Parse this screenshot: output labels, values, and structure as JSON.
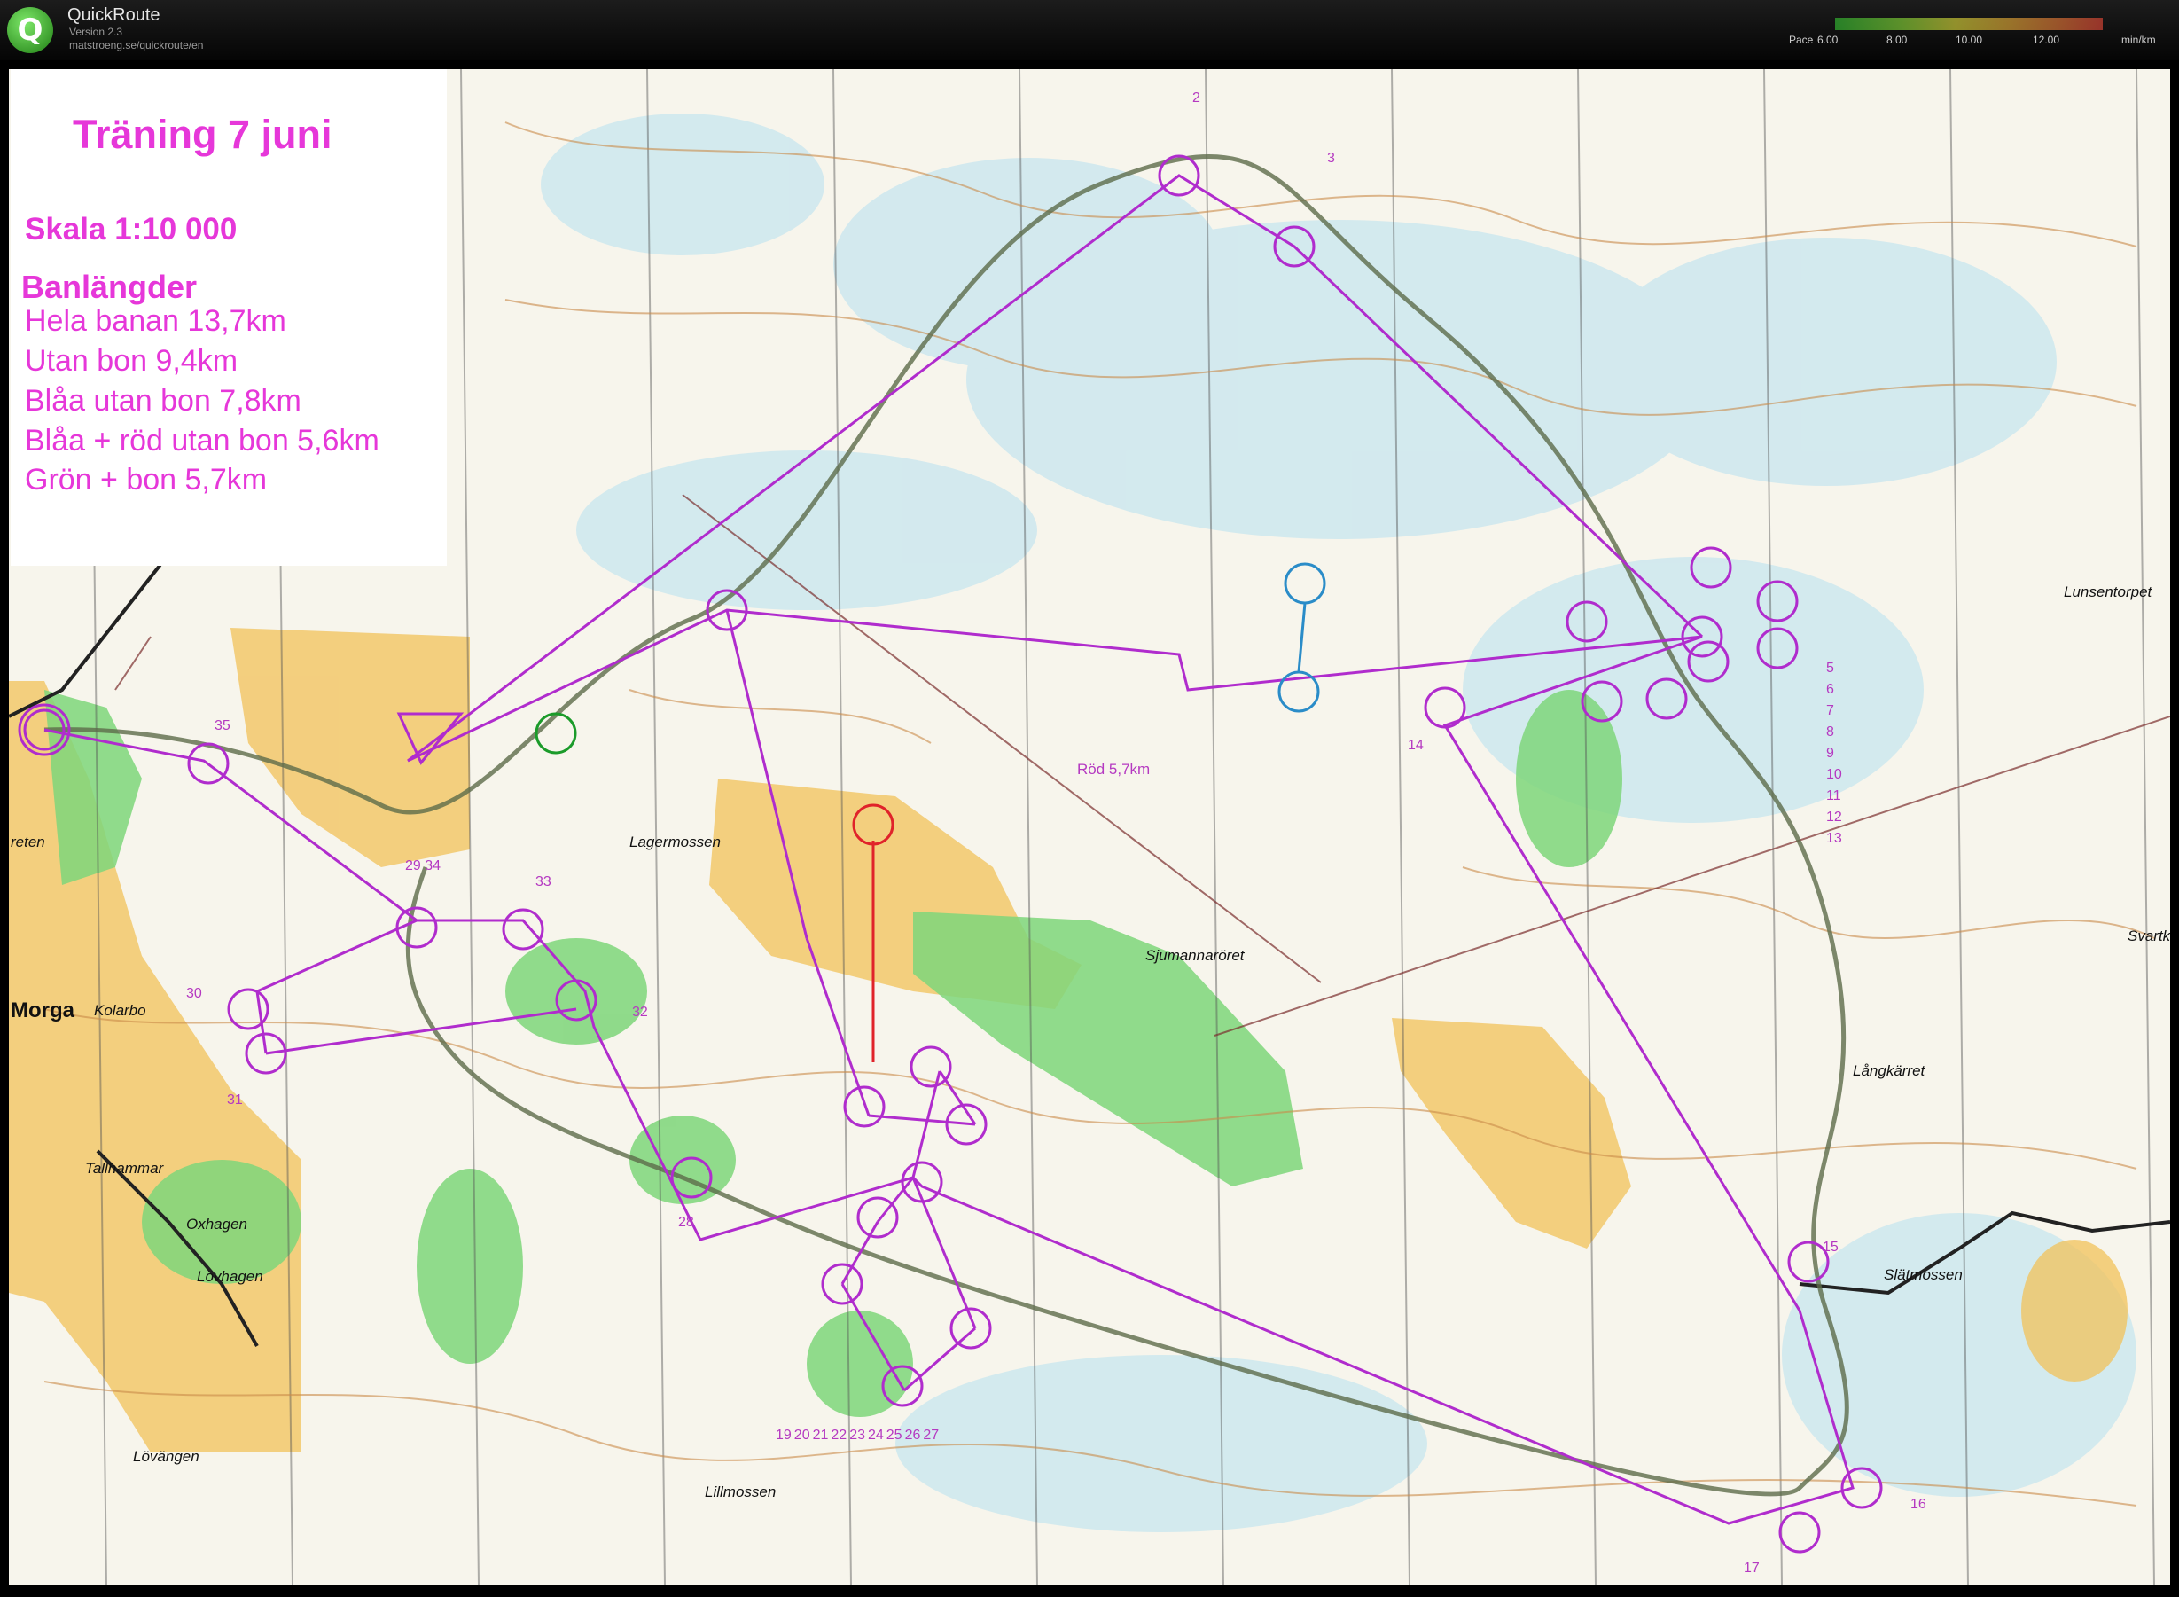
{
  "app": {
    "title": "QuickRoute",
    "version": "Version 2.3",
    "url": "matstroeng.se/quickroute/en"
  },
  "pace_scale": {
    "label": "Pace",
    "ticks": [
      "6.00",
      "8.00",
      "10.00",
      "12.00"
    ],
    "unit": "min/km",
    "colors": [
      "#35c935",
      "#8ee43a",
      "#e7e43c",
      "#f2b43a",
      "#f27a3a",
      "#f04a3a"
    ]
  },
  "legend": {
    "title": "Träning 7 juni",
    "scale": "Skala 1:10 000",
    "heading": "Banlängder",
    "lines": [
      "Hela banan 13,7km",
      "Utan bon 9,4km",
      "Blåa utan bon 7,8km",
      "Blåa + röd utan bon 5,6km",
      "Grön + bon 5,7km"
    ]
  },
  "map": {
    "route_label": "Röd 5,7km",
    "places": {
      "lagermossen": "Lagermossen",
      "sjumannaroret": "Sjumannaröret",
      "langkarret": "Långkärret",
      "slatmossen": "Slätmossen",
      "lillmossen": "Lillmossen",
      "lunsentorpet": "Lunsentorpet",
      "svartk": "Svartk",
      "morga": "Morga",
      "kolarbo": "Kolarbo",
      "tallhammar": "Tallhammar",
      "oxhagen": "Oxhagen",
      "lovhagen": "Lövhagen",
      "lovangen": "Lövängen",
      "reten": "reten"
    },
    "controls": {
      "c2": "2",
      "c3": "3",
      "c14": "14",
      "c15": "15",
      "c16": "16",
      "c17": "17",
      "c28": "28",
      "c29_34": "29 34",
      "c30": "30",
      "c31": "31",
      "c32": "32",
      "c33": "33",
      "c35": "35",
      "seq_5_13": [
        "5",
        "6",
        "7",
        "8",
        "9",
        "10",
        "11",
        "12",
        "13"
      ],
      "seq_19_27": [
        "19",
        "20",
        "21",
        "22",
        "23",
        "24",
        "25",
        "26",
        "27"
      ]
    },
    "colors": {
      "course": "#b02ccd",
      "blue_course": "#2a8cc8",
      "green_course": "#1b9b2a",
      "red_course": "#e0232a",
      "contour": "#c98a4a",
      "open_land": "#f2c15a",
      "green_veg": "#7ed67a",
      "marsh": "#c7e6ef"
    }
  }
}
